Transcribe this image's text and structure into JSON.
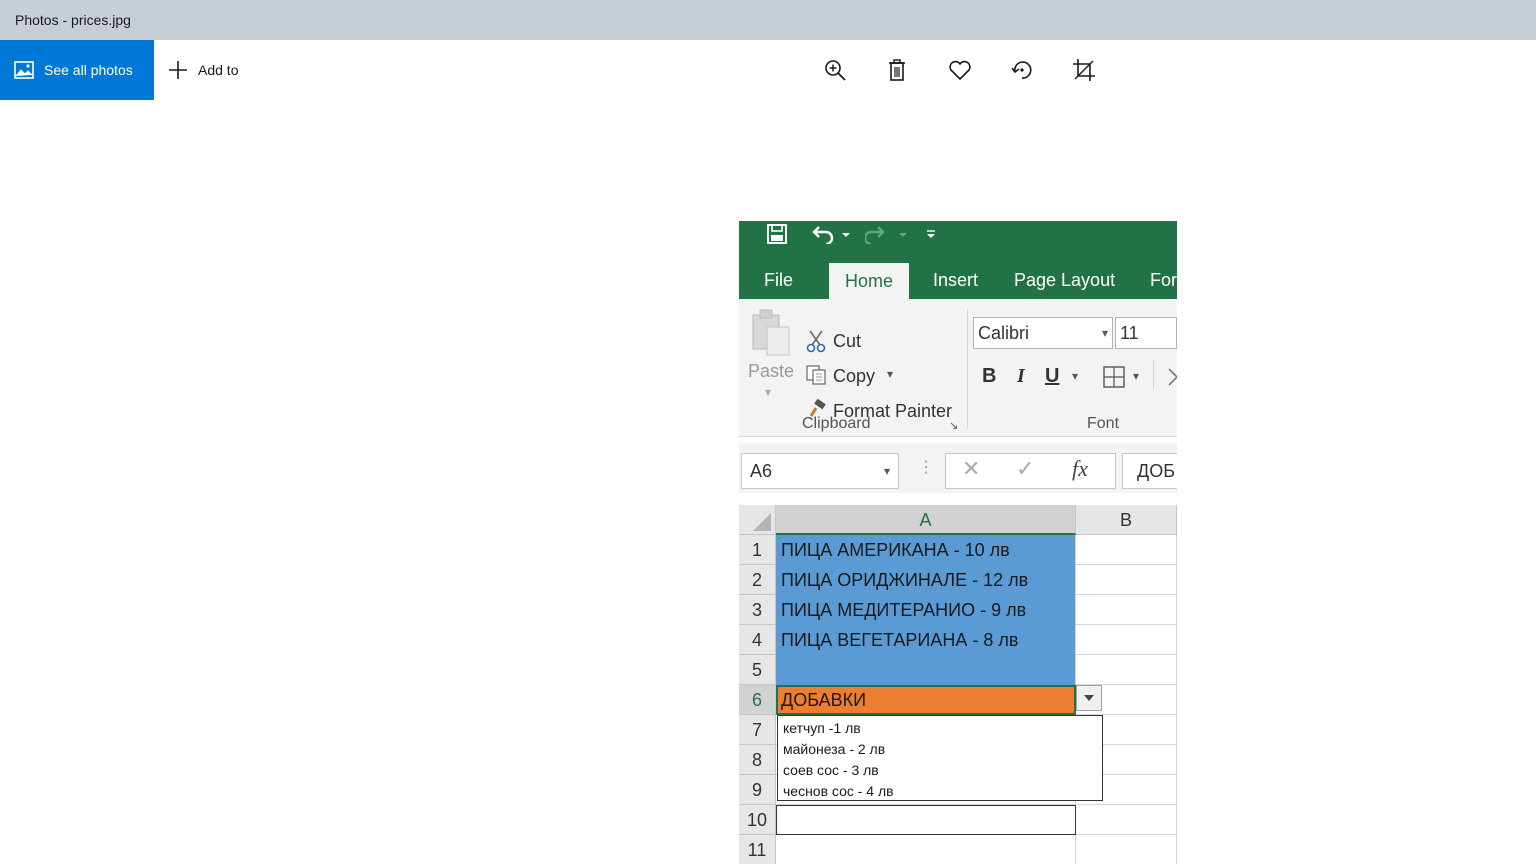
{
  "window": {
    "title": "Photos - prices.jpg"
  },
  "toolbar": {
    "see_all_label": "See all photos",
    "add_to_label": "Add to",
    "icons": [
      "zoom-in-icon",
      "delete-icon",
      "favorite-icon",
      "rotate-icon",
      "crop-icon"
    ],
    "accent_color": "#0078d7"
  },
  "excel": {
    "tabs": [
      "File",
      "Home",
      "Insert",
      "Page Layout",
      "For"
    ],
    "clipboard": {
      "paste_label": "Paste",
      "cut_label": "Cut",
      "copy_label": "Copy",
      "format_painter_label": "Format Painter",
      "group_label": "Clipboard"
    },
    "font": {
      "name": "Calibri",
      "size": "11",
      "bold": "B",
      "italic": "I",
      "underline": "U",
      "group_label": "Font"
    },
    "name_box": "A6",
    "formula_value": "ДОБ",
    "columns": [
      "A",
      "B"
    ],
    "rows": [
      "1",
      "2",
      "3",
      "4",
      "5",
      "6",
      "7",
      "8",
      "9",
      "10",
      "11"
    ],
    "cells": {
      "a1": "ПИЦА АМЕРИКАНА - 10 лв",
      "a2": "ПИЦА ОРИДЖИНАЛЕ - 12 лв",
      "a3": "ПИЦА МЕДИТЕРАНИО - 9 лв",
      "a4": "ПИЦА ВЕГЕТАРИАНА - 8 лв",
      "a6": "ДОБАВКИ"
    },
    "dropdown_options": [
      "кетчуп -1 лв",
      "майонеза - 2 лв",
      "соев сос - 3 лв",
      "чеснов сос - 4 лв"
    ],
    "colors": {
      "excel_green": "#217346",
      "blue_fill": "#5b9bd5",
      "orange_fill": "#ed7d31"
    }
  }
}
